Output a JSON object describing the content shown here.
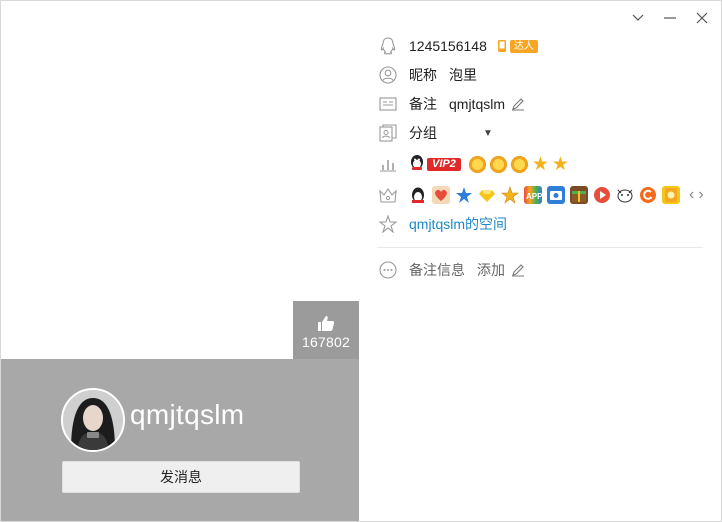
{
  "profile": {
    "qq_number": "1245156148",
    "badge_daren": "达人",
    "nickname_label": "昵称",
    "nickname": "泡里",
    "remark_label": "备注",
    "remark": "qmjtqslm",
    "group_label": "分组",
    "vip_label": "VIP2",
    "space_link": "qmjtqslm的空间",
    "remark_info_label": "备注信息",
    "add_label": "添加"
  },
  "card": {
    "display_name": "qmjtqslm",
    "likes": "167802",
    "send_message": "发消息"
  },
  "colors": {
    "left_panel": "#a8a8a8",
    "like_box": "#9b9b9b",
    "link": "#1e88c7"
  }
}
